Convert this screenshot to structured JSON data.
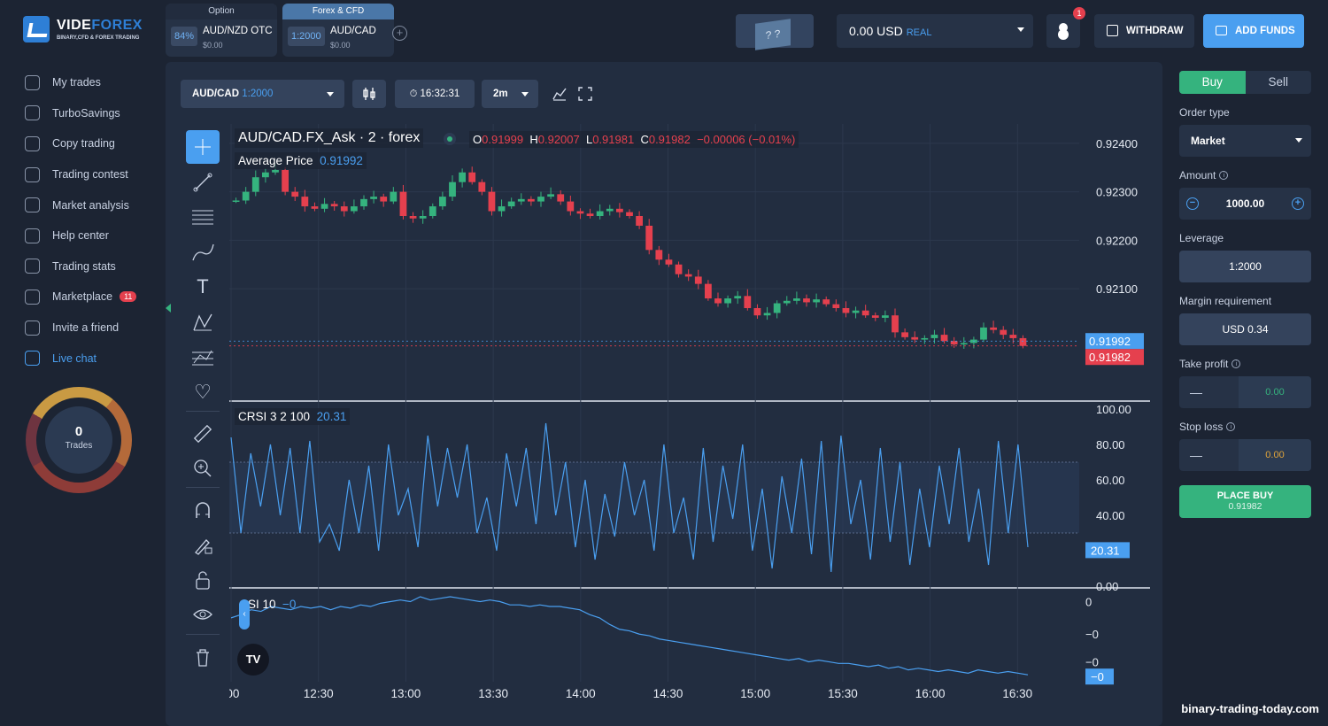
{
  "brand": {
    "name_a": "VIDE",
    "name_b": "FOREX",
    "tagline": "BINARY,CFD & FOREX TRADING"
  },
  "nav": [
    {
      "label": "My trades",
      "icon": "briefcase-icon"
    },
    {
      "label": "TurboSavings",
      "icon": "savings-icon"
    },
    {
      "label": "Copy trading",
      "icon": "copy-icon"
    },
    {
      "label": "Trading contest",
      "icon": "trophy-icon"
    },
    {
      "label": "Market analysis",
      "icon": "analysis-icon"
    },
    {
      "label": "Help center",
      "icon": "info-icon"
    },
    {
      "label": "Trading stats",
      "icon": "stats-icon"
    },
    {
      "label": "Marketplace",
      "icon": "gear-icon",
      "badge": "11"
    },
    {
      "label": "Invite a friend",
      "icon": "people-icon"
    },
    {
      "label": "Live chat",
      "icon": "chat-icon",
      "active": true
    }
  ],
  "trades_gauge": {
    "count": "0",
    "label": "Trades"
  },
  "tabs": [
    {
      "category": "Option",
      "badge": "84%",
      "symbol": "AUD/NZD OTC",
      "amount": "$0.00"
    },
    {
      "category": "Forex & CFD",
      "badge": "1:2000",
      "symbol": "AUD/CAD",
      "amount": "$0.00",
      "active": true
    }
  ],
  "header": {
    "balance": "0.00 USD",
    "account_type": "REAL",
    "notifications": "1",
    "withdraw": "WITHDRAW",
    "add_funds": "ADD FUNDS",
    "promo_glyph": "? ?"
  },
  "chart_toolbar": {
    "symbol": "AUD/CAD",
    "leverage": "1:2000",
    "time": "16:32:31",
    "interval": "2m"
  },
  "legend": {
    "title": "AUD/CAD.FX_Ask · 2 · forex",
    "o_label": "O",
    "o": "0.91999",
    "h_label": "H",
    "h": "0.92007",
    "l_label": "L",
    "l": "0.91981",
    "c_label": "C",
    "c": "0.91982",
    "change": "−0.00006 (−0.01%)",
    "avg_label": "Average Price",
    "avg_value": "0.91992",
    "crsi_label": "CRSI 3 2 100",
    "crsi_value": "20.31",
    "si_label": "SI 10",
    "si_value": "−0"
  },
  "colors": {
    "up": "#35b37e",
    "down": "#e5404e",
    "accent": "#4a9ff0",
    "bg": "#1c2433",
    "panel": "#222d40"
  },
  "watermark": "binary-trading-today.com",
  "order": {
    "buy": "Buy",
    "sell": "Sell",
    "order_type_label": "Order type",
    "order_type": "Market",
    "amount_label": "Amount",
    "amount": "1000.00",
    "leverage_label": "Leverage",
    "leverage": "1:2000",
    "margin_label": "Margin requirement",
    "margin": "USD 0.34",
    "tp_label": "Take profit",
    "tp_value": "0.00",
    "sl_label": "Stop loss",
    "sl_value": "0.00",
    "dash": "—",
    "place_label": "PLACE BUY",
    "place_price": "0.91982"
  },
  "chart_data": [
    {
      "type": "candlestick",
      "title": "AUD/CAD.FX_Ask · 2 · forex",
      "x_ticks": [
        ":00",
        "12:30",
        "13:00",
        "13:30",
        "14:00",
        "14:30",
        "15:00",
        "15:30",
        "16:00",
        "16:30"
      ],
      "y_ticks": [
        "0.92400",
        "0.92300",
        "0.92200",
        "0.92100"
      ],
      "ylim": [
        0.9187,
        0.9244
      ],
      "price_tags": {
        "ask": "0.91992",
        "bid": "0.91982"
      },
      "close": [
        0.92282,
        0.923,
        0.9233,
        0.9234,
        0.92345,
        0.923,
        0.9229,
        0.9227,
        0.92265,
        0.92275,
        0.9227,
        0.9226,
        0.9227,
        0.92285,
        0.9229,
        0.9228,
        0.923,
        0.9225,
        0.92245,
        0.9225,
        0.9227,
        0.9229,
        0.9232,
        0.9234,
        0.9232,
        0.923,
        0.9226,
        0.9227,
        0.9228,
        0.92285,
        0.9228,
        0.9229,
        0.92295,
        0.9228,
        0.9226,
        0.92255,
        0.9225,
        0.9226,
        0.92265,
        0.92258,
        0.9225,
        0.9223,
        0.9218,
        0.9216,
        0.9215,
        0.9213,
        0.92125,
        0.9211,
        0.9208,
        0.9207,
        0.9208,
        0.92085,
        0.9206,
        0.92045,
        0.9205,
        0.9207,
        0.92075,
        0.9208,
        0.92072,
        0.92078,
        0.92068,
        0.9206,
        0.9205,
        0.92055,
        0.92045,
        0.9204,
        0.92045,
        0.9201,
        0.92,
        0.91995,
        0.91998,
        0.92005,
        0.91992,
        0.91985,
        0.91988,
        0.91995,
        0.9202,
        0.92015,
        0.92005,
        0.91998,
        0.91982
      ]
    },
    {
      "type": "line",
      "name": "CRSI 3 2 100",
      "yticks": [
        "100.00",
        "80.00",
        "60.00",
        "40.00",
        "0.00"
      ],
      "ylim": [
        0,
        100
      ],
      "last": "20.31",
      "values": [
        84,
        30,
        75,
        45,
        80,
        40,
        78,
        30,
        82,
        25,
        35,
        20,
        60,
        30,
        68,
        20,
        80,
        40,
        55,
        22,
        85,
        45,
        78,
        50,
        80,
        30,
        50,
        20,
        75,
        45,
        78,
        35,
        92,
        40,
        70,
        22,
        60,
        15,
        52,
        28,
        70,
        40,
        60,
        20,
        80,
        30,
        50,
        15,
        78,
        25,
        68,
        38,
        80,
        20,
        55,
        10,
        62,
        30,
        72,
        18,
        82,
        8,
        85,
        35,
        60,
        15,
        78,
        25,
        70,
        12,
        55,
        22,
        68,
        35,
        78,
        25,
        55,
        12,
        82,
        30,
        80,
        22
      ]
    },
    {
      "type": "line",
      "name": "SI 10",
      "yticks": [
        "0",
        "−0",
        "−0"
      ],
      "last": "−0",
      "values": [
        0.2,
        0.22,
        0.25,
        0.24,
        0.27,
        0.26,
        0.25,
        0.27,
        0.26,
        0.27,
        0.25,
        0.27,
        0.26,
        0.28,
        0.27,
        0.29,
        0.3,
        0.31,
        0.3,
        0.33,
        0.31,
        0.32,
        0.33,
        0.32,
        0.31,
        0.3,
        0.31,
        0.3,
        0.28,
        0.28,
        0.27,
        0.28,
        0.27,
        0.27,
        0.26,
        0.25,
        0.22,
        0.2,
        0.16,
        0.13,
        0.12,
        0.1,
        0.09,
        0.07,
        0.06,
        0.05,
        0.04,
        0.03,
        0.02,
        0.01,
        0.0,
        -0.01,
        -0.02,
        -0.03,
        -0.04,
        -0.05,
        -0.06,
        -0.05,
        -0.07,
        -0.06,
        -0.07,
        -0.08,
        -0.08,
        -0.09,
        -0.1,
        -0.09,
        -0.11,
        -0.1,
        -0.12,
        -0.11,
        -0.12,
        -0.13,
        -0.12,
        -0.13,
        -0.14,
        -0.12,
        -0.13,
        -0.14,
        -0.13,
        -0.14,
        -0.15
      ]
    }
  ]
}
